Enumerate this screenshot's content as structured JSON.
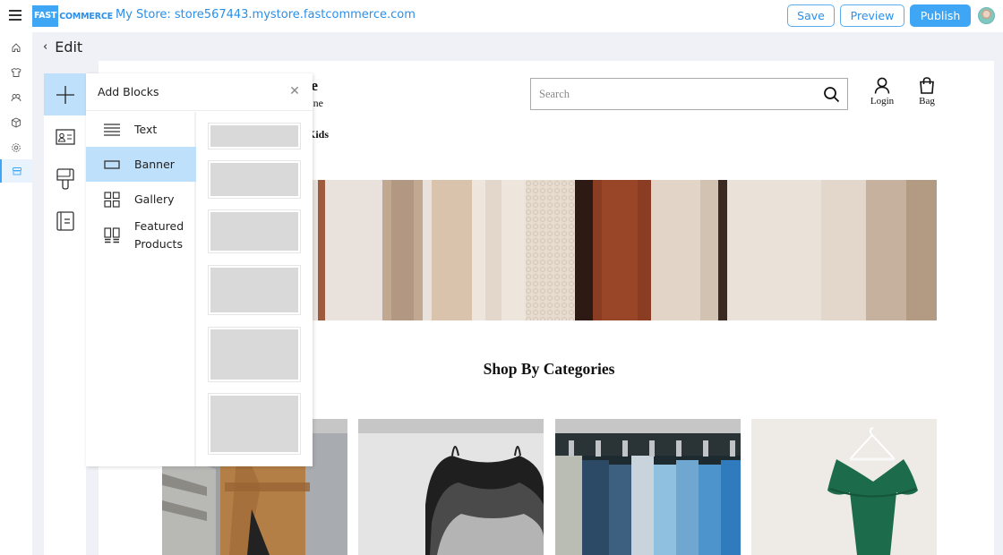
{
  "topbar": {
    "logo_fast": "FAST",
    "logo_commerce": "COMMERCE",
    "store_title": "My Store: store567443.mystore.fastcommerce.com",
    "save_label": "Save",
    "preview_label": "Preview",
    "publish_label": "Publish",
    "accent_color": "#3ea6f4"
  },
  "app_nav": {
    "items": [
      {
        "name": "home",
        "icon": "home-icon"
      },
      {
        "name": "products",
        "icon": "tshirt-icon"
      },
      {
        "name": "customers",
        "icon": "users-icon"
      },
      {
        "name": "inventory",
        "icon": "box-icon"
      },
      {
        "name": "settings",
        "icon": "gear-icon"
      },
      {
        "name": "store",
        "icon": "storefront-icon",
        "active": true
      }
    ]
  },
  "editor": {
    "back_label": "Edit",
    "tools": [
      {
        "name": "add-blocks",
        "icon": "plus-icon",
        "active": true
      },
      {
        "name": "contact-card",
        "icon": "contact-card-icon"
      },
      {
        "name": "theme-paint",
        "icon": "paint-roller-icon"
      },
      {
        "name": "pages",
        "icon": "page-list-icon"
      }
    ]
  },
  "add_blocks": {
    "title": "Add Blocks",
    "items": [
      {
        "label": "Text",
        "icon": "text-lines-icon"
      },
      {
        "label": "Banner",
        "icon": "banner-icon",
        "active": true
      },
      {
        "label": "Gallery",
        "icon": "gallery-grid-icon"
      },
      {
        "label": "Featured Products",
        "label_line1": "Featured",
        "label_line2": "Products",
        "icon": "featured-products-icon"
      }
    ],
    "thumbnail_count": 6
  },
  "store_page": {
    "brand_title_fragment": "e",
    "brand_subtitle_fragment": "ne",
    "nav_fragment": "Kids",
    "search_placeholder": "Search",
    "login_label": "Login",
    "bag_label": "Bag",
    "section_title": "Shop By Categories",
    "categories": [
      {
        "image": "coat"
      },
      {
        "image": "camisoles"
      },
      {
        "image": "jeans"
      },
      {
        "image": "green-dress"
      }
    ]
  }
}
